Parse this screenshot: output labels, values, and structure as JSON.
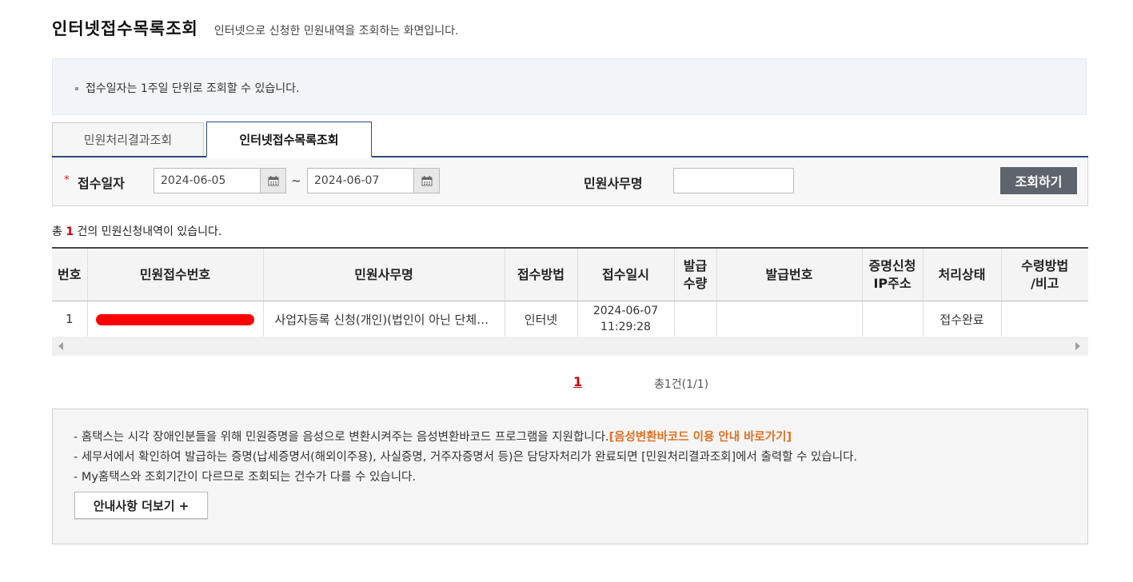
{
  "header": {
    "title": "인터넷접수목록조회",
    "subtitle": "인터넷으로 신청한 민원내역을 조회하는 화면입니다."
  },
  "notice": {
    "text": "접수일자는 1주일 단위로 조회할 수 있습니다."
  },
  "tabs": [
    {
      "label": "민원처리결과조회",
      "active": false
    },
    {
      "label": "인터넷접수목록조회",
      "active": true
    }
  ],
  "search": {
    "required_mark": "*",
    "date_label": "접수일자",
    "date_from": "2024-06-05",
    "date_to": "2024-06-07",
    "tilde": "~",
    "name_label": "민원사무명",
    "name_value": "",
    "button_label": "조회하기"
  },
  "summary": {
    "prefix": "총",
    "count": "1",
    "suffix": "건의 민원신청내역이 있습니다."
  },
  "table": {
    "headers": [
      "번호",
      "민원접수번호",
      "민원사무명",
      "접수방법",
      "접수일시",
      "발급\n수량",
      "발급번호",
      "증명신청\nIP주소",
      "처리상태",
      "수령방법\n/비고"
    ],
    "rows": [
      {
        "no": "1",
        "receipt_no": "",
        "name": "사업자등록 신청(개인)(법인이 아닌 단체의 고유번호 신청 포함)",
        "method": "인터넷",
        "date": "2024-06-07",
        "time": "11:29:28",
        "qty": "",
        "issue_no": "",
        "ip": "",
        "status": "접수완료",
        "remark": ""
      }
    ]
  },
  "pagination": {
    "current": "1",
    "total": "총1건(1/1)"
  },
  "guide": {
    "line1": "- 홈택스는 시각 장애인분들을 위해 민원증명을 음성으로 변환시켜주는 음성변환바코드 프로그램을 지원합니다.",
    "line1_link": "[음성변환바코드 이용 안내 바로가기]",
    "line2": "- 세무서에서 확인하여 발급하는 증명(납세증명서(해외이주용), 사실증명, 거주자증명서 등)은 담당자처리가 완료되면 [민원처리결과조회]에서 출력할 수 있습니다.",
    "line3": "- My홈택스와 조회기간이 다르므로 조회되는 건수가 다를 수 있습니다.",
    "more_button": "안내사항 더보기 +"
  },
  "colors": {
    "accent_red": "#cc0000",
    "tab_border": "#2b4a7a",
    "search_button": "#5e646c",
    "link_orange": "#e07020",
    "redaction": "#ff0000"
  }
}
